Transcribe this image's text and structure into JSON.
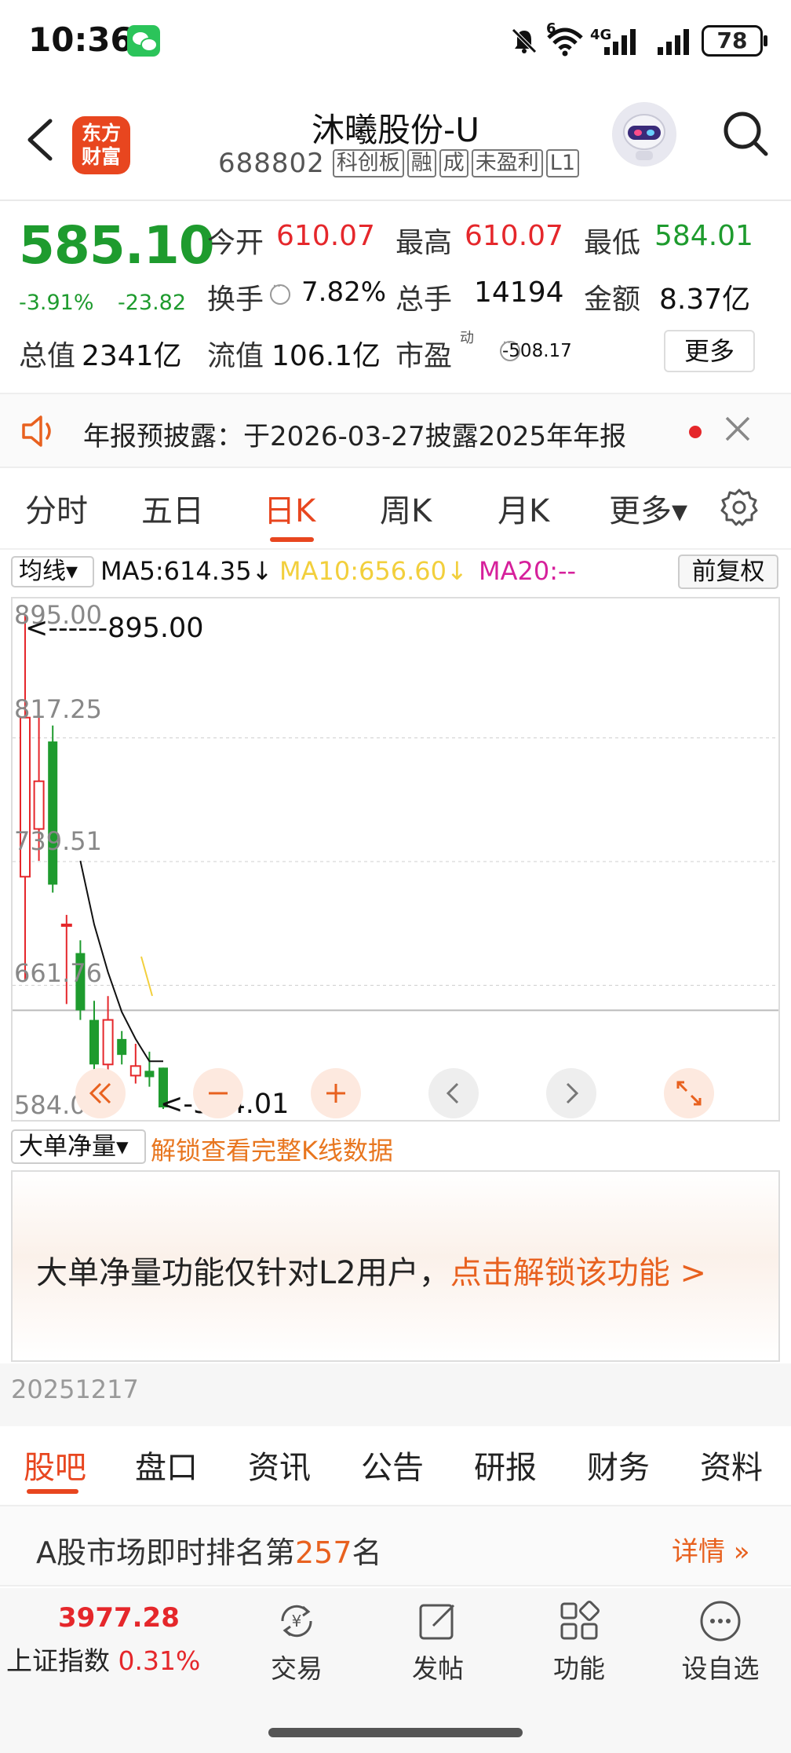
{
  "status_bar": {
    "time": "10:36",
    "network": "4G",
    "wifi_badge": "6",
    "battery": "78"
  },
  "header": {
    "logo_line1": "东方",
    "logo_line2": "财富",
    "stock_name": "沐曦股份-U",
    "stock_code": "688802",
    "tags": [
      "科创板",
      "融",
      "成",
      "未盈利",
      "L1"
    ]
  },
  "quote": {
    "price": "585.10",
    "change_pct": "-3.91%",
    "change_amt": "-23.82",
    "open_label": "今开",
    "open": "610.07",
    "high_label": "最高",
    "high": "610.07",
    "low_label": "最低",
    "low": "584.01",
    "turnover_label": "换手",
    "turnover": "7.82%",
    "volume_label": "总手",
    "volume": "14194",
    "amount_label": "金额",
    "amount": "8.37亿",
    "mktcap_label": "总值",
    "mktcap": "2341亿",
    "float_label": "流值",
    "float_cap": "106.1亿",
    "pe_label": "市盈",
    "pe_sup": "动",
    "pe": "-508.17",
    "more_button": "更多"
  },
  "notice": {
    "text": "年报预披露：于2026-03-27披露2025年年报"
  },
  "chart_tabs": {
    "items": [
      "分时",
      "五日",
      "日K",
      "周K",
      "月K",
      "更多▾"
    ],
    "active_index": 2
  },
  "ma_bar": {
    "select": "均线▾",
    "ma5": "MA5:614.35↓",
    "ma10": "MA10:656.60↓",
    "ma20": "MA20:--",
    "adjust": "前复权",
    "colors": {
      "ma5": "#111111",
      "ma10": "#f2cf3c",
      "ma20": "#d6209b"
    }
  },
  "chart_data": {
    "type": "candlestick",
    "y_ticks": [
      "895.00",
      "817.25",
      "739.51",
      "661.76",
      "584.01"
    ],
    "ylim": [
      584.01,
      895.0
    ],
    "max_marker": "<------895.00",
    "min_marker": "<-584.01",
    "up_color": "#e5272b",
    "down_color": "#1e9b2e",
    "candles": [
      {
        "open": 730,
        "close": 830,
        "high": 895,
        "low": 665,
        "dir": "up"
      },
      {
        "open": 760,
        "close": 790,
        "high": 840,
        "low": 740,
        "dir": "up"
      },
      {
        "open": 815,
        "close": 725,
        "high": 825,
        "low": 720,
        "dir": "down"
      },
      {
        "open": 700,
        "close": 700,
        "high": 706,
        "low": 650,
        "dir": "up"
      },
      {
        "open": 682,
        "close": 646,
        "high": 690,
        "low": 640,
        "dir": "down"
      },
      {
        "open": 640,
        "close": 612,
        "high": 652,
        "low": 608,
        "dir": "down"
      },
      {
        "open": 612,
        "close": 640,
        "high": 655,
        "low": 592,
        "dir": "up"
      },
      {
        "open": 618,
        "close": 628,
        "high": 633,
        "low": 612,
        "dir": "down"
      },
      {
        "open": 605,
        "close": 611,
        "high": 625,
        "low": 600,
        "dir": "up"
      },
      {
        "open": 608,
        "close": 604,
        "high": 620,
        "low": 598,
        "dir": "down"
      },
      {
        "open": 610,
        "close": 585,
        "high": 610,
        "low": 584,
        "dir": "down"
      }
    ],
    "ma5_line": [
      null,
      null,
      null,
      null,
      740,
      700,
      670,
      645,
      628,
      614,
      614
    ],
    "ma10_segment": [
      null,
      null,
      null,
      null,
      null,
      null,
      null,
      null,
      null,
      null,
      null
    ]
  },
  "indicator": {
    "select": "大单净量▾",
    "unlock_link": "解锁查看完整K线数据",
    "panel_text": "大单净量功能仅针对L2用户，",
    "panel_link": "点击解锁该功能 >",
    "date": "20251217"
  },
  "section_tabs": {
    "items": [
      "股吧",
      "盘口",
      "资讯",
      "公告",
      "研报",
      "财务",
      "资料"
    ],
    "active_index": 0
  },
  "rank": {
    "prefix": "A股市场即时排名第",
    "number": "257",
    "suffix": "名",
    "detail": "详情"
  },
  "bottom_nav": {
    "index_value": "3977.28",
    "index_name": "上证指数",
    "index_change": "0.31%",
    "items": [
      {
        "label": "交易",
        "icon": "trade-icon"
      },
      {
        "label": "发帖",
        "icon": "post-icon"
      },
      {
        "label": "功能",
        "icon": "grid-icon"
      },
      {
        "label": "设自选",
        "icon": "more-dots-icon"
      }
    ]
  }
}
